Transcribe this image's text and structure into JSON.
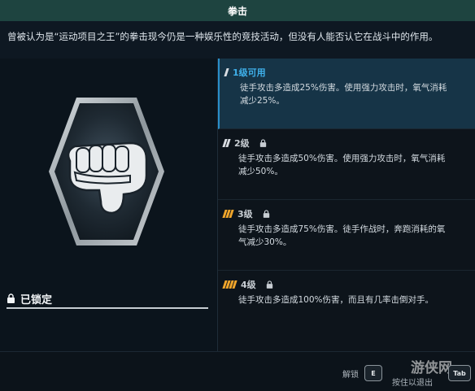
{
  "title": "拳击",
  "description": "曾被认为是“运动项目之王”的拳击现今仍是一种娱乐性的竞技活动，但没有人能否认它在战斗中的作用。",
  "left_panel": {
    "status_label": "已锁定"
  },
  "tiers": [
    {
      "name": "1级可用",
      "locked": false,
      "active": true,
      "bars": 1,
      "bar_color": "#d9dde2",
      "line1": "徒手攻击多造成25%伤害。使用强力攻击时，氧气消耗",
      "line2": "减少25%。"
    },
    {
      "name": "2级",
      "locked": true,
      "active": false,
      "bars": 2,
      "bar_color": "#d9dde2",
      "line1": "徒手攻击多造成50%伤害。使用强力攻击时，氧气消耗",
      "line2": "减少50%。"
    },
    {
      "name": "3级",
      "locked": true,
      "active": false,
      "bars": 3,
      "bar_color": "#f0a52b",
      "line1": "徒手攻击多造成75%伤害。徒手作战时，奔跑消耗的氧",
      "line2": "气减少30%。"
    },
    {
      "name": "4级",
      "locked": true,
      "active": false,
      "bars": 4,
      "bar_color": "#f0a52b",
      "line1": "徒手攻击多造成100%伤害，而且有几率击倒对手。",
      "line2": ""
    }
  ],
  "footer": {
    "unlock_label": "解锁",
    "unlock_key": "E",
    "hold_exit_label": "按住以退出",
    "exit_key": "Tab",
    "watermark": "游侠网"
  },
  "colors": {
    "accent": "#3fb0ea",
    "title_bg": "#1e4440",
    "tier_orange": "#f0a52b",
    "active_bg": "#163447"
  }
}
